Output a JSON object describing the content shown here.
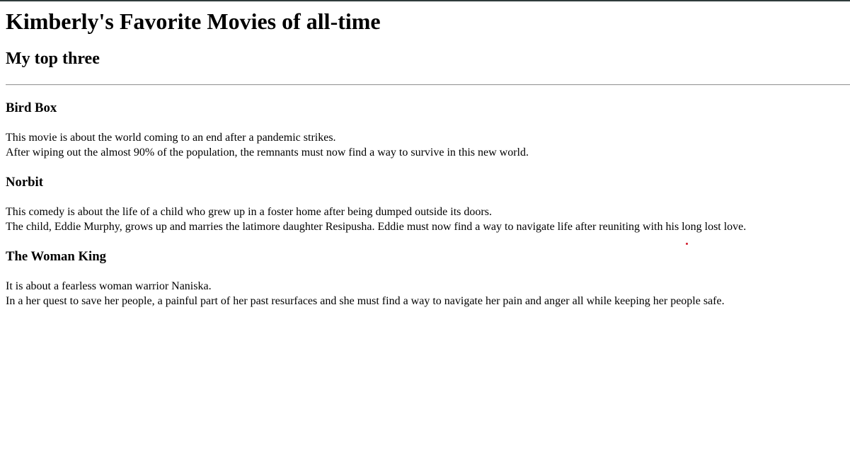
{
  "page": {
    "title": "Kimberly's Favorite Movies of all-time",
    "subtitle": "My top three"
  },
  "movies": [
    {
      "title": "Bird Box",
      "line1": "This movie is about the world coming to an end after a pandemic strikes.",
      "line2": "After wiping out the almost 90% of the population, the remnants must now find a way to survive in this new world."
    },
    {
      "title": "Norbit",
      "line1": "This comedy is about the life of a child who grew up in a foster home after being dumped outside its doors.",
      "line2": "The child, Eddie Murphy, grows up and marries the latimore daughter Resipusha. Eddie must now find a way to navigate life after reuniting with his long lost love."
    },
    {
      "title": "The Woman King",
      "line1": "It is about a fearless woman warrior Naniska.",
      "line2": "In a her quest to save her people, a painful part of her past resurfaces and she must find a way to navigate her pain and anger all while keeping her people safe."
    }
  ],
  "colors": {
    "text": "#000000",
    "background": "#ffffff",
    "divider": "#9a9a9a",
    "top_border": "#2f3b3b",
    "marker_dot": "#d11a2a"
  }
}
